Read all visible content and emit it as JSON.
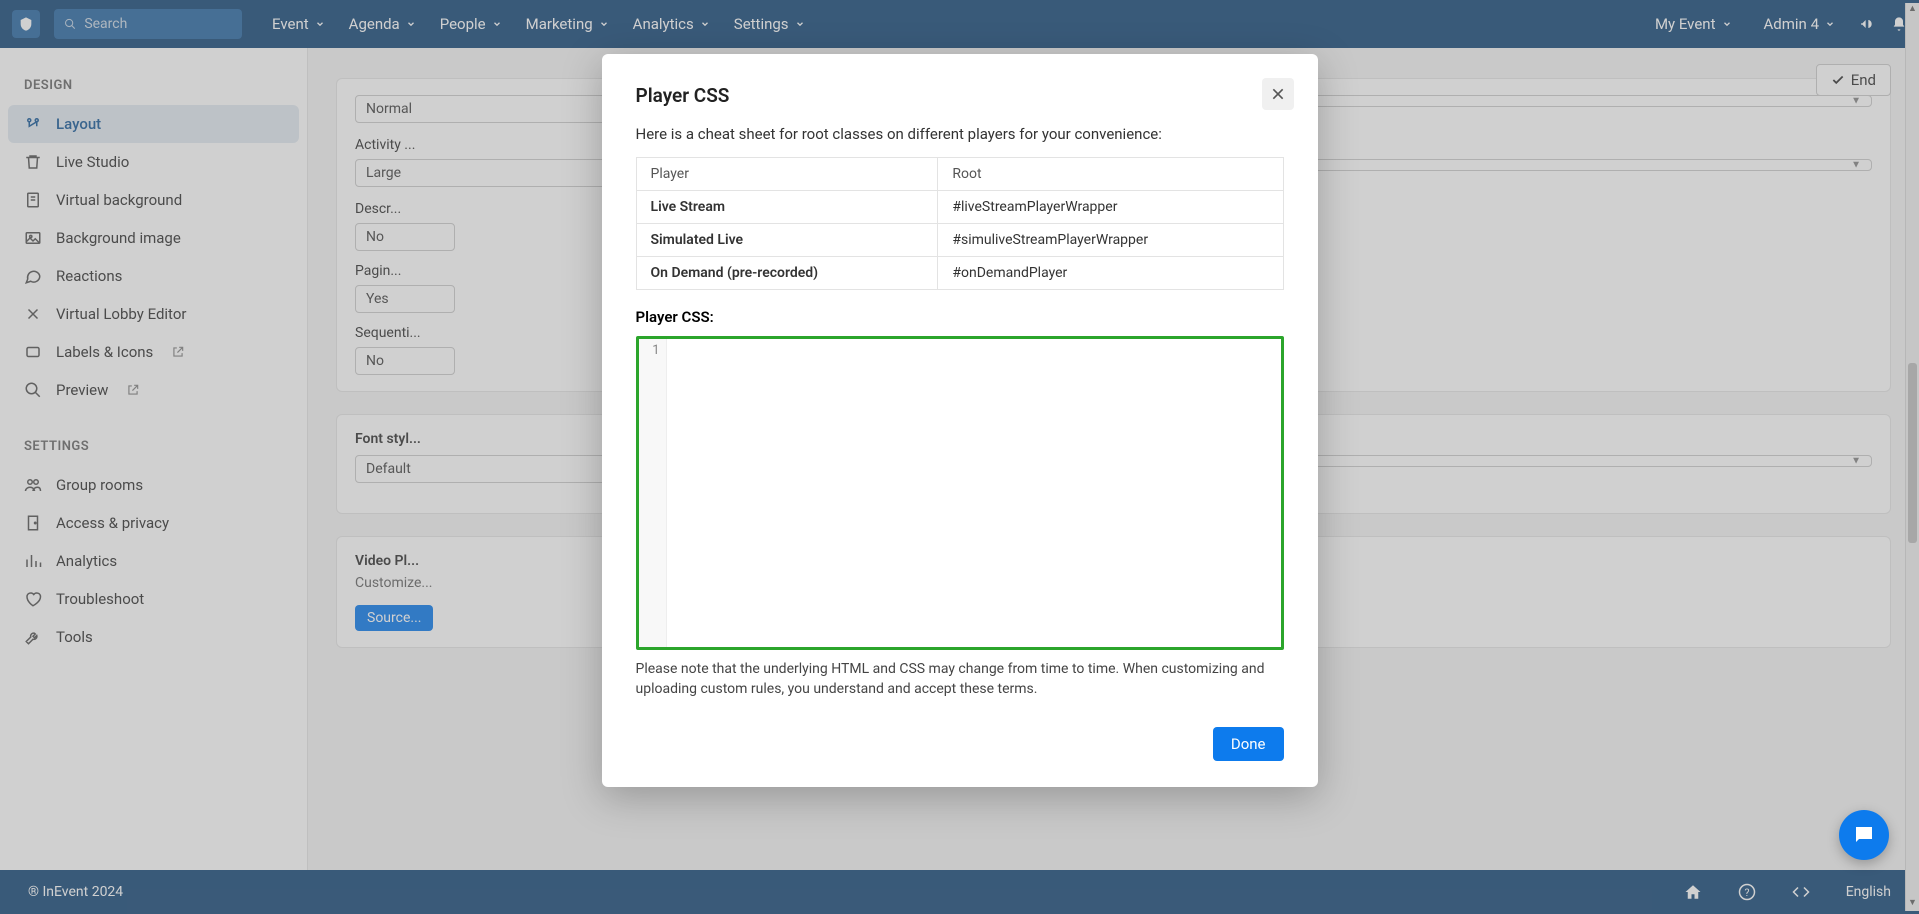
{
  "topbar": {
    "search_placeholder": "Search",
    "nav": [
      {
        "label": "Event"
      },
      {
        "label": "Agenda"
      },
      {
        "label": "People"
      },
      {
        "label": "Marketing"
      },
      {
        "label": "Analytics"
      },
      {
        "label": "Settings"
      }
    ],
    "my_event": "My Event",
    "admin": "Admin 4"
  },
  "sidebar": {
    "design_heading": "DESIGN",
    "design_items": [
      {
        "label": "Layout",
        "icon": "layout"
      },
      {
        "label": "Live Studio",
        "icon": "trash"
      },
      {
        "label": "Virtual background",
        "icon": "doc"
      },
      {
        "label": "Background image",
        "icon": "image"
      },
      {
        "label": "Reactions",
        "icon": "chat"
      },
      {
        "label": "Virtual Lobby Editor",
        "icon": "tools"
      },
      {
        "label": "Labels & Icons",
        "icon": "tag",
        "ext": true
      },
      {
        "label": "Preview",
        "icon": "search",
        "ext": true
      }
    ],
    "settings_heading": "SETTINGS",
    "settings_items": [
      {
        "label": "Group rooms",
        "icon": "people"
      },
      {
        "label": "Access & privacy",
        "icon": "door"
      },
      {
        "label": "Analytics",
        "icon": "stats"
      },
      {
        "label": "Troubleshoot",
        "icon": "heart"
      },
      {
        "label": "Tools",
        "icon": "wrench"
      }
    ]
  },
  "main": {
    "end_label": "End",
    "f_normal": "Normal",
    "f_activity_label": "Activity ...",
    "f_activity_value": "Large",
    "f_desc_label": "Descr...",
    "f_desc_value": "No",
    "f_pagin_label": "Pagin...",
    "f_pagin_value": "Yes",
    "f_sequent_label": "Sequenti...",
    "f_sequent_value": "No",
    "font_style_label": "Font styl...",
    "font_style_value": "Default",
    "video_heading": "Video Pl...",
    "video_sub": "Customize...",
    "source_btn": "Source..."
  },
  "modal": {
    "title": "Player CSS",
    "desc": "Here is a cheat sheet for root classes on different players for your convenience:",
    "col_player": "Player",
    "col_root": "Root",
    "rows": [
      {
        "player": "Live Stream",
        "root": "#liveStreamPlayerWrapper"
      },
      {
        "player": "Simulated Live",
        "root": "#simuliveStreamPlayerWrapper"
      },
      {
        "player": "On Demand (pre-recorded)",
        "root": "#onDemandPlayer"
      }
    ],
    "css_label": "Player CSS:",
    "line1": "1",
    "note": "Please note that the underlying HTML and CSS may change from time to time. When customizing and uploading custom rules, you understand and accept these terms.",
    "done": "Done"
  },
  "footer": {
    "copyright": "® InEvent 2024",
    "language": "English"
  }
}
